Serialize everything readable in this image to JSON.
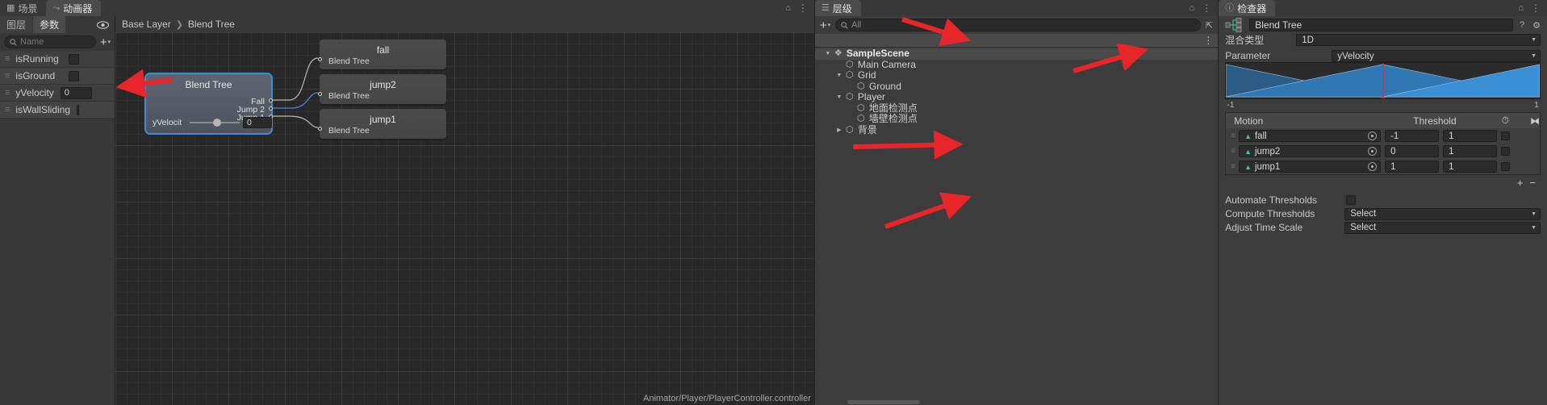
{
  "animator": {
    "tabs": [
      {
        "label": "场景",
        "icon": "grid-icon",
        "active": false
      },
      {
        "label": "动画器",
        "icon": "animator-icon",
        "active": true
      }
    ],
    "window_buttons": {
      "lock": "lock-icon",
      "menu": "kebab-menu-icon"
    },
    "param_tabs": [
      {
        "label": "图层",
        "selected": false
      },
      {
        "label": "参数",
        "selected": true
      }
    ],
    "eye_icon": "eye-icon",
    "search": {
      "placeholder": "Name",
      "value": "",
      "icon": "search-icon"
    },
    "add_button": {
      "label": "+",
      "caret": "▾"
    },
    "parameters": [
      {
        "name": "isRunning",
        "type": "bool",
        "value": ""
      },
      {
        "name": "isGround",
        "type": "bool",
        "value": ""
      },
      {
        "name": "yVelocity",
        "type": "float",
        "value": "0"
      },
      {
        "name": "isWallSliding",
        "type": "bool",
        "value": ""
      }
    ],
    "breadcrumb": [
      "Base Layer",
      "Blend Tree"
    ],
    "status_text": "Animator/Player/PlayerController.controller",
    "nodes": {
      "blend_tree": {
        "title": "Blend Tree",
        "ports": [
          "Fall",
          "Jump 2",
          "Jump 1"
        ],
        "slider_label": "yVelocit",
        "slider_value": "0"
      },
      "children": [
        {
          "title": "fall",
          "sub": "Blend Tree"
        },
        {
          "title": "jump2",
          "sub": "Blend Tree"
        },
        {
          "title": "jump1",
          "sub": "Blend Tree"
        }
      ]
    }
  },
  "hierarchy": {
    "tab": {
      "label": "层级",
      "icon": "hierarchy-icon"
    },
    "add_button": {
      "label": "+",
      "caret": "▾"
    },
    "search": {
      "placeholder": "All",
      "value": "",
      "icon": "search-icon"
    },
    "expand_icon": "expand-icon",
    "menu_icon": "kebab-menu-icon",
    "items": [
      {
        "label": "SampleScene",
        "depth": 0,
        "expanded": true,
        "icon": "unity-scene-icon",
        "is_scene": true
      },
      {
        "label": "Main Camera",
        "depth": 1,
        "expanded": null,
        "icon": "gameobject-icon",
        "is_scene": false
      },
      {
        "label": "Grid",
        "depth": 1,
        "expanded": true,
        "icon": "gameobject-icon",
        "is_scene": false
      },
      {
        "label": "Ground",
        "depth": 2,
        "expanded": null,
        "icon": "gameobject-icon",
        "is_scene": false
      },
      {
        "label": "Player",
        "depth": 1,
        "expanded": true,
        "icon": "gameobject-icon",
        "is_scene": false
      },
      {
        "label": "地面检测点",
        "depth": 2,
        "expanded": null,
        "icon": "gameobject-icon",
        "is_scene": false
      },
      {
        "label": "墙壁检测点",
        "depth": 2,
        "expanded": null,
        "icon": "gameobject-icon",
        "is_scene": false
      },
      {
        "label": "背景",
        "depth": 1,
        "expanded": false,
        "icon": "gameobject-icon",
        "is_scene": false
      }
    ]
  },
  "inspector": {
    "tab": {
      "label": "检查器",
      "icon": "info-icon"
    },
    "lock_icon": "lock-icon",
    "menu_icon": "kebab-menu-icon",
    "asset_icon": "blendtree-icon",
    "name": "Blend Tree",
    "help_icon": "help-icon",
    "settings_icon": "gear-icon",
    "blend_type": {
      "label": "混合类型",
      "value": "1D"
    },
    "parameter": {
      "label": "Parameter",
      "value": "yVelocity"
    },
    "blend_graph": {
      "min": "-1",
      "max": "1",
      "marker_position_pct": 50
    },
    "motion_table": {
      "headers": {
        "motion": "Motion",
        "threshold": "Threshold",
        "time_scale_icon": "time-scale-icon",
        "mirror_icon": "mirror-icon"
      },
      "rows": [
        {
          "motion": "fall",
          "threshold": "-1",
          "time_scale": "1",
          "mirror": false
        },
        {
          "motion": "jump2",
          "threshold": "0",
          "time_scale": "1",
          "mirror": false
        },
        {
          "motion": "jump1",
          "threshold": "1",
          "time_scale": "1",
          "mirror": false
        }
      ],
      "add_label": "+",
      "remove_label": "−"
    },
    "options": [
      {
        "label": "Automate Thresholds",
        "type": "checkbox",
        "value": false
      },
      {
        "label": "Compute Thresholds",
        "type": "dropdown",
        "value": "Select"
      },
      {
        "label": "Adjust Time Scale",
        "type": "dropdown",
        "value": "Select"
      }
    ]
  },
  "colors": {
    "accent_blue": "#3d8ce0",
    "annotation_red": "#e8262a",
    "motion_green": "#39c7a8",
    "graph_blue": "#2f6a9e"
  }
}
